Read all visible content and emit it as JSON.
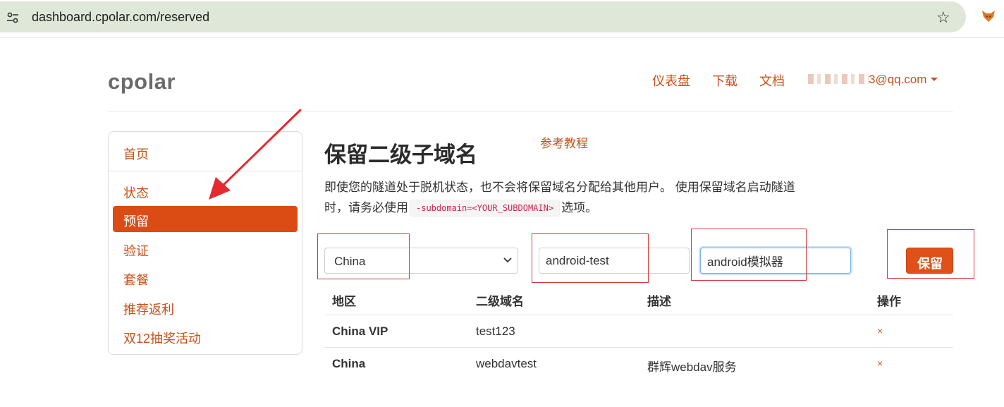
{
  "browser": {
    "url": "dashboard.cpolar.com/reserved",
    "site_info_icon": "tune-icon",
    "bookmark_icon": "star-outline-icon",
    "extension_icon": "fox-extension-icon"
  },
  "header": {
    "logo": "cpolar",
    "nav": [
      "仪表盘",
      "下载",
      "文档"
    ],
    "user_email_visible": "3@qq.com"
  },
  "sidebar": {
    "items": [
      "首页",
      "状态",
      "预留",
      "验证",
      "套餐",
      "推荐返利",
      "双12抽奖活动"
    ],
    "active": "预留"
  },
  "main": {
    "title": "保留二级子域名",
    "reference_link": "参考教程",
    "desc_1": "即使您的隧道处于脱机状态，也不会将保留域名分配给其他用户。 使用保留域名启动隧道",
    "desc_2": "时，请务必使用",
    "desc_code": "-subdomain=<YOUR_SUBDOMAIN>",
    "desc_3": "选项。",
    "form": {
      "region": "China",
      "subdomain": "android-test",
      "description": "android模拟器",
      "submit": "保留"
    },
    "table": {
      "headers": [
        "地区",
        "二级域名",
        "描述",
        "操作"
      ],
      "rows": [
        {
          "region": "China VIP",
          "subdomain": "test123",
          "description": "",
          "action": "×"
        },
        {
          "region": "China",
          "subdomain": "webdavtest",
          "description": "群辉webdav服务",
          "action": "×"
        }
      ]
    }
  },
  "colors": {
    "accent": "#db4c15",
    "link": "#c8501a",
    "annotation": "#d8343a"
  }
}
